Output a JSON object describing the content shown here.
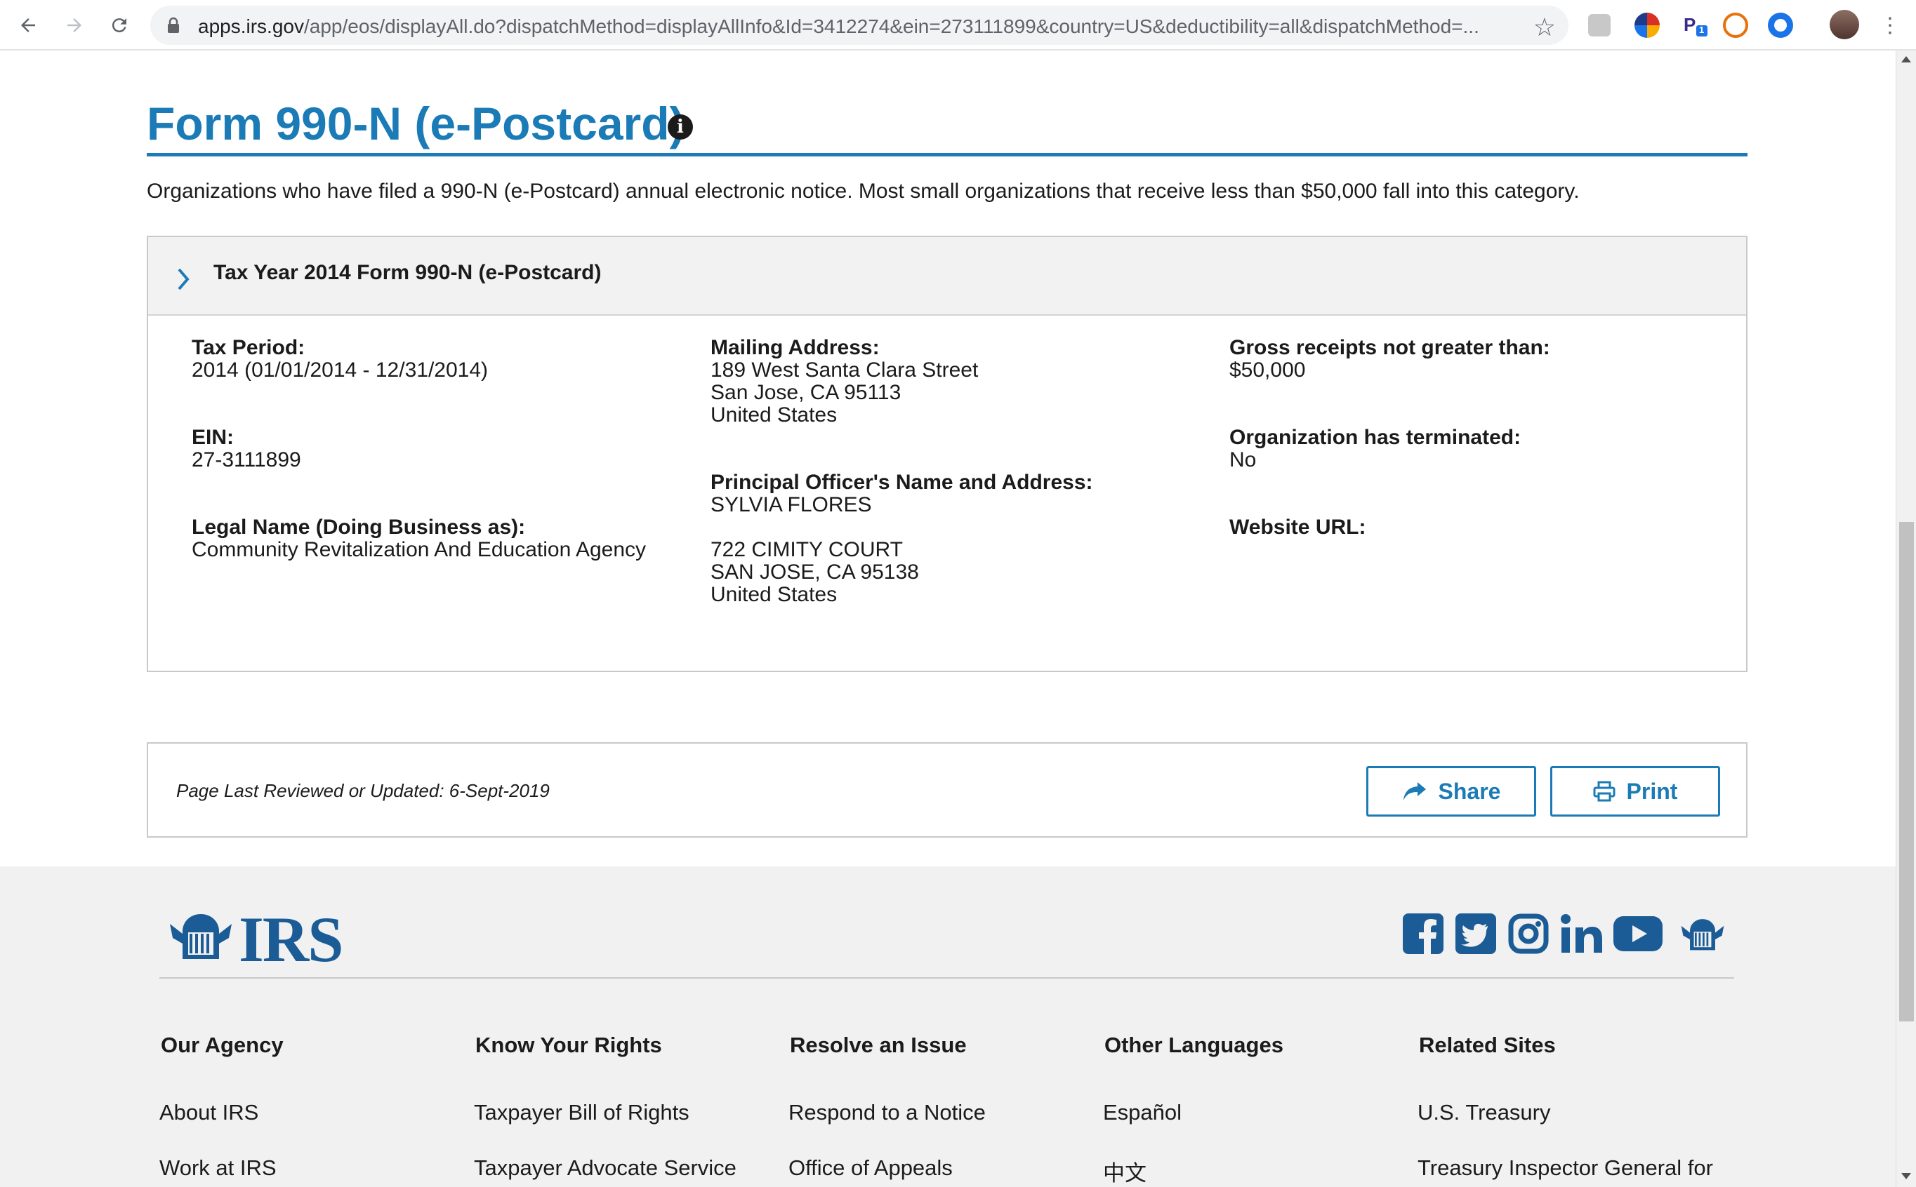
{
  "browser": {
    "url_host": "apps.irs.gov",
    "url_path": "/app/eos/displayAll.do?dispatchMethod=displayAllInfo&Id=3412274&ein=273111899&country=US&deductibility=all&dispatchMethod=...",
    "extension_badge": "1"
  },
  "form": {
    "title": "Form 990-N (e-Postcard)",
    "info_glyph": "i",
    "intro": "Organizations who have filed a 990-N (e-Postcard) annual electronic notice. Most small organizations that receive less than $50,000 fall into this category.",
    "panel_title": "Tax Year 2014 Form 990-N (e-Postcard)",
    "tax_period": {
      "label": "Tax Period:",
      "value": "2014 (01/01/2014 - 12/31/2014)"
    },
    "ein": {
      "label": "EIN:",
      "value": "27-3111899"
    },
    "legal_name": {
      "label": "Legal Name (Doing Business as):",
      "value": "Community Revitalization And Education Agency"
    },
    "mailing_address": {
      "label": "Mailing Address:",
      "line1": "189 West Santa Clara Street",
      "line2": "San Jose, CA 95113",
      "line3": "United States"
    },
    "principal_officer": {
      "label": "Principal Officer's Name and Address:",
      "name": "SYLVIA FLORES",
      "line1": "722 CIMITY COURT",
      "line2": "SAN JOSE, CA 95138",
      "line3": "United States"
    },
    "gross_receipts": {
      "label": "Gross receipts not greater than:",
      "value": "$50,000"
    },
    "terminated": {
      "label": "Organization has terminated:",
      "value": "No"
    },
    "website": {
      "label": "Website URL:",
      "value": ""
    }
  },
  "review": {
    "text": "Page Last Reviewed or Updated: 6-Sept-2019",
    "share_label": "Share",
    "print_label": "Print"
  },
  "footer": {
    "logo_text": "IRS",
    "social_icons": [
      "facebook-icon",
      "twitter-icon",
      "instagram-icon",
      "linkedin-icon",
      "youtube-icon",
      "irs-eagle-icon"
    ],
    "columns": [
      {
        "heading": "Our Agency",
        "links": [
          "About IRS",
          "Work at IRS"
        ]
      },
      {
        "heading": "Know Your Rights",
        "links": [
          "Taxpayer Bill of Rights",
          "Taxpayer Advocate Service"
        ]
      },
      {
        "heading": "Resolve an Issue",
        "links": [
          "Respond to a Notice",
          "Office of Appeals"
        ]
      },
      {
        "heading": "Other Languages",
        "links": [
          "Español",
          "中文"
        ]
      },
      {
        "heading": "Related Sites",
        "links": [
          "U.S. Treasury",
          "Treasury Inspector General for"
        ]
      }
    ]
  },
  "colors": {
    "irs_blue": "#1b7bb6",
    "footer_blue": "#1b5c96",
    "footer_bg": "#f1f1f1"
  }
}
